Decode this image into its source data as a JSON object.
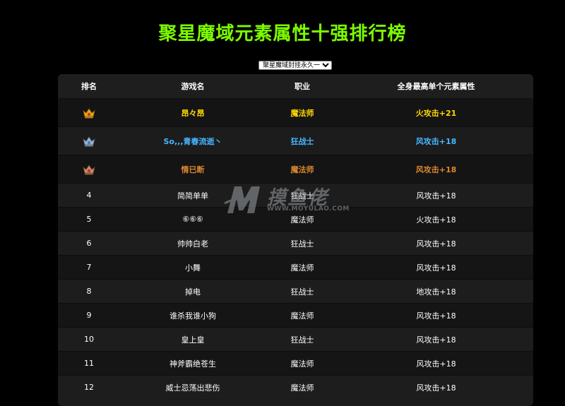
{
  "page": {
    "title": "聚星魔域元素属性十强排行榜",
    "server_select": {
      "selected": "聚星魔域封挂永久一区",
      "options": [
        "聚星魔域封挂永久一区"
      ]
    }
  },
  "table": {
    "headers": {
      "rank": "排名",
      "name": "游戏名",
      "class": "职业",
      "attr": "全身最高单个元素属性"
    },
    "top3": [
      {
        "medal": "gold-crown-medal-icon",
        "name": "昂々昂",
        "class": "魔法师",
        "attr": "火攻击+21",
        "color": "#ffd700"
      },
      {
        "medal": "silver-crown-medal-icon",
        "name": "So,,,青春流逝丶",
        "class": "狂战士",
        "attr": "风攻击+18",
        "color": "#47b6ff"
      },
      {
        "medal": "bronze-crown-medal-icon",
        "name": "情已断",
        "class": "魔法师",
        "attr": "风攻击+18",
        "color": "#d9862e"
      }
    ],
    "rows": [
      {
        "rank": "4",
        "name": "简简单单",
        "class": "狂战士",
        "attr": "风攻击+18"
      },
      {
        "rank": "5",
        "name": "⑥⑥⑥",
        "class": "魔法师",
        "attr": "火攻击+18"
      },
      {
        "rank": "6",
        "name": "帅帅白老",
        "class": "狂战士",
        "attr": "风攻击+18"
      },
      {
        "rank": "7",
        "name": "小舞",
        "class": "魔法师",
        "attr": "风攻击+18"
      },
      {
        "rank": "8",
        "name": "掉电",
        "class": "狂战士",
        "attr": "地攻击+18"
      },
      {
        "rank": "9",
        "name": "谁杀我谁小狗",
        "class": "魔法师",
        "attr": "风攻击+18"
      },
      {
        "rank": "10",
        "name": "皇上皇",
        "class": "狂战士",
        "attr": "风攻击+18"
      },
      {
        "rank": "11",
        "name": "神斧霸绝苍生",
        "class": "魔法师",
        "attr": "风攻击+18"
      },
      {
        "rank": "12",
        "name": "威士忌荡出悲伤",
        "class": "魔法师",
        "attr": "风攻击+18"
      }
    ]
  },
  "watermark": {
    "logo": "moyulao-m-logo-icon",
    "text_cn": "摸鱼佬",
    "text_en": "WWW.MOYULAO.COM"
  },
  "colors": {
    "background": "#000000",
    "title": "#7cfc00",
    "gold": "#ffd700",
    "silver": "#47b6ff",
    "bronze": "#d9862e"
  }
}
